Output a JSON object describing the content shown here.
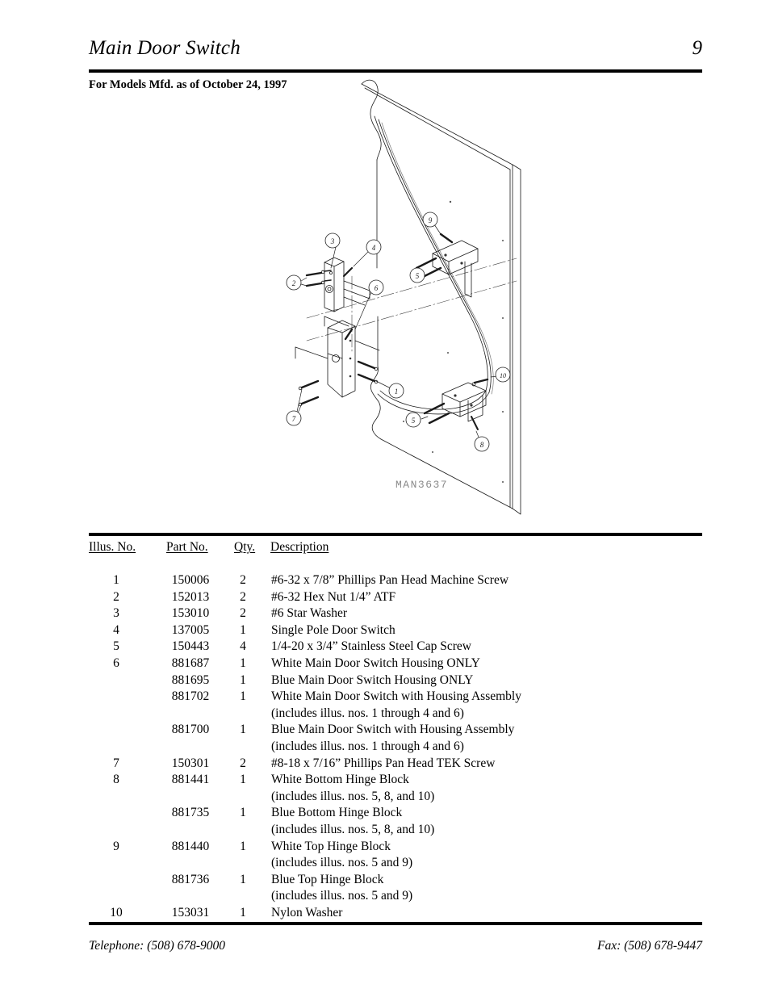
{
  "header": {
    "title": "Main Door Switch",
    "page_number": "9",
    "subtitle": "For Models Mfd. as of October 24, 1997"
  },
  "figure": {
    "drawing_number": "MAN3637",
    "callouts": [
      "1",
      "2",
      "3",
      "4",
      "5",
      "6",
      "7",
      "8",
      "9",
      "10"
    ]
  },
  "table": {
    "columns": [
      "Illus. No.",
      "Part  No.",
      "Qty.",
      "Description"
    ],
    "rows": [
      {
        "illus": "1",
        "part": "150006",
        "qty": "2",
        "desc": "#6-32 x 7/8” Phillips Pan Head Machine Screw"
      },
      {
        "illus": "2",
        "part": "152013",
        "qty": "2",
        "desc": "#6-32 Hex Nut 1/4” ATF"
      },
      {
        "illus": "3",
        "part": "153010",
        "qty": "2",
        "desc": "#6  Star  Washer"
      },
      {
        "illus": "4",
        "part": "137005",
        "qty": "1",
        "desc": "Single Pole Door Switch"
      },
      {
        "illus": "5",
        "part": "150443",
        "qty": "4",
        "desc": "1/4-20 x 3/4” Stainless Steel Cap Screw"
      },
      {
        "illus": "6",
        "part": "881687",
        "qty": "1",
        "desc": "White Main Door Switch Housing ONLY"
      },
      {
        "illus": "",
        "part": "881695",
        "qty": "1",
        "desc": "Blue Main Door Switch Housing ONLY"
      },
      {
        "illus": "",
        "part": "881702",
        "qty": "1",
        "desc": "White Main Door Switch with Housing Assembly"
      },
      {
        "illus": "",
        "part": "",
        "qty": "",
        "desc": "(includes illus. nos. 1 through 4 and 6)",
        "continuation": true
      },
      {
        "illus": "",
        "part": "881700",
        "qty": "1",
        "desc": "Blue Main Door Switch with Housing Assembly"
      },
      {
        "illus": "",
        "part": "",
        "qty": "",
        "desc": "(includes illus. nos. 1 through 4 and 6)",
        "continuation": true
      },
      {
        "illus": "7",
        "part": "150301",
        "qty": "2",
        "desc": "#8-18 x 7/16” Phillips Pan Head TEK Screw"
      },
      {
        "illus": "8",
        "part": "881441",
        "qty": "1",
        "desc": "White Bottom Hinge Block"
      },
      {
        "illus": "",
        "part": "",
        "qty": "",
        "desc": "(includes illus. nos. 5, 8, and 10)",
        "continuation": true
      },
      {
        "illus": "",
        "part": "881735",
        "qty": "1",
        "desc": "Blue Bottom Hinge Block"
      },
      {
        "illus": "",
        "part": "",
        "qty": "",
        "desc": "(includes illus. nos. 5, 8, and 10)",
        "continuation": true
      },
      {
        "illus": "9",
        "part": "881440",
        "qty": "1",
        "desc": "White Top Hinge Block"
      },
      {
        "illus": "",
        "part": "",
        "qty": "",
        "desc": "(includes illus. nos. 5 and 9)",
        "continuation": true
      },
      {
        "illus": "",
        "part": "881736",
        "qty": "1",
        "desc": "Blue Top Hinge Block"
      },
      {
        "illus": "",
        "part": "",
        "qty": "",
        "desc": "(includes illus. nos. 5 and 9)",
        "continuation": true
      },
      {
        "illus": "10",
        "part": "153031",
        "qty": "1",
        "desc": "Nylon Washer"
      }
    ]
  },
  "footer": {
    "telephone": "Telephone: (508) 678-9000",
    "fax": "Fax: (508) 678-9447"
  }
}
